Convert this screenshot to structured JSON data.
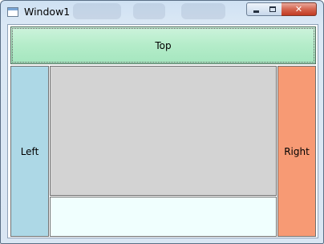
{
  "window": {
    "title": "Window1",
    "controls": {
      "minimize_icon": "minimize-icon",
      "maximize_icon": "maximize-icon",
      "close_glyph": "✕"
    }
  },
  "panels": {
    "top": {
      "label": "Top",
      "color": "#b4ecc9"
    },
    "left": {
      "label": "Left",
      "color": "#add8e6"
    },
    "center": {
      "label": "",
      "color": "#d3d3d3"
    },
    "bottom": {
      "label": "",
      "color": "#f0fffe"
    },
    "right": {
      "label": "Right",
      "color": "#f79a74"
    }
  }
}
